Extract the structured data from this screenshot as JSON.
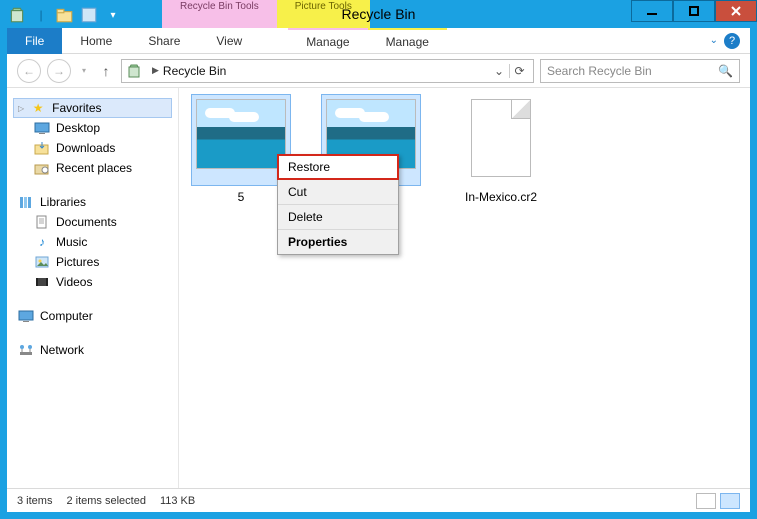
{
  "titlebar": {
    "tools_group1": "Recycle Bin Tools",
    "tools_group2": "Picture Tools",
    "title": "Recycle Bin"
  },
  "ribbon": {
    "file": "File",
    "tabs": [
      "Home",
      "Share",
      "View"
    ],
    "manage1": "Manage",
    "manage2": "Manage"
  },
  "nav": {
    "crumb_sep": "▶",
    "location": "Recycle Bin",
    "search_placeholder": "Search Recycle Bin"
  },
  "sidebar": {
    "favorites": {
      "label": "Favorites",
      "items": [
        "Desktop",
        "Downloads",
        "Recent places"
      ]
    },
    "libraries": {
      "label": "Libraries",
      "items": [
        "Documents",
        "Music",
        "Pictures",
        "Videos"
      ]
    },
    "computer": "Computer",
    "network": "Network"
  },
  "items": [
    {
      "name": "5",
      "kind": "image"
    },
    {
      "name": "",
      "kind": "image"
    },
    {
      "name": "In-Mexico.cr2",
      "kind": "file"
    }
  ],
  "context_menu": {
    "items": [
      "Restore",
      "Cut",
      "Delete",
      "Properties"
    ],
    "highlighted": 0,
    "default": 3
  },
  "status": {
    "count": "3 items",
    "selection": "2 items selected",
    "size": "113 KB"
  }
}
